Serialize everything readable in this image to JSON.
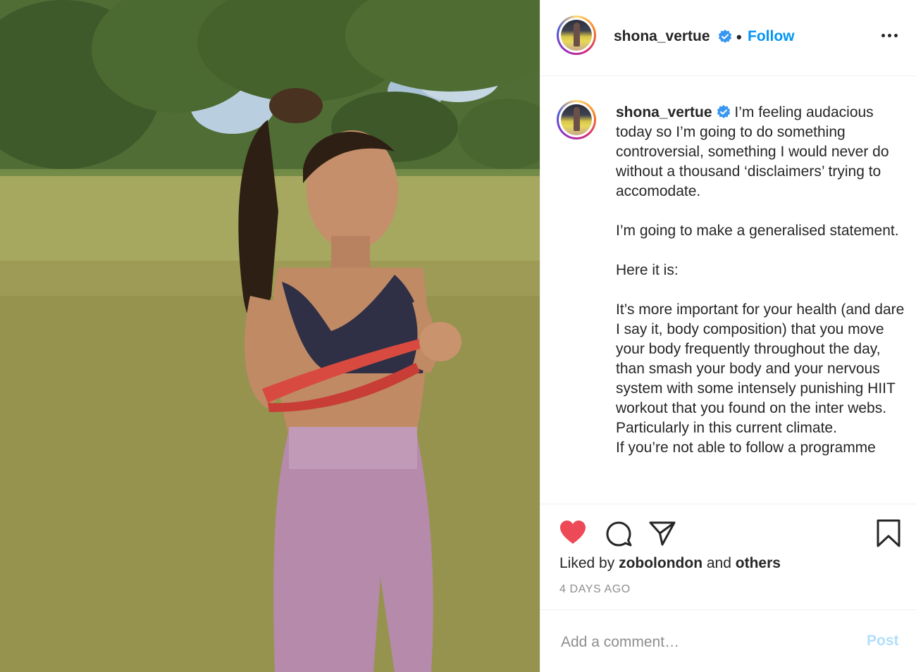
{
  "header": {
    "username": "shona_vertue",
    "separator": "•",
    "follow_label": "Follow"
  },
  "caption": {
    "username": "shona_vertue",
    "text": " I’m feeling audacious today so I’m going to do something controversial, something I would never do without a thousand ‘disclaimers’ trying to accomodate.\n\nI’m going to make a generalised statement.\n\nHere it is:\n\nIt’s more important for your health (and dare I say it, body composition) that you move your body frequently throughout the day, than smash your body and your nervous system with some intensely punishing HIIT workout that you found on the inter webs. Particularly in this current climate.\nIf you’re not able to follow a programme"
  },
  "likes": {
    "prefix": "Liked by ",
    "user": "zobolondon",
    "middle": " and ",
    "others": "others"
  },
  "timestamp": "4 DAYS AGO",
  "comment": {
    "placeholder": "Add a comment…",
    "post_label": "Post"
  },
  "icons": {
    "like": "heart-icon",
    "comment": "comment-bubble-icon",
    "share": "paper-plane-icon",
    "save": "bookmark-icon",
    "more": "more-options-icon",
    "verified": "verified-badge-icon"
  },
  "colors": {
    "link_blue": "#0095f6",
    "like_red": "#ed4956",
    "muted": "#8e8e8e",
    "post_disabled": "#b2dffc"
  }
}
